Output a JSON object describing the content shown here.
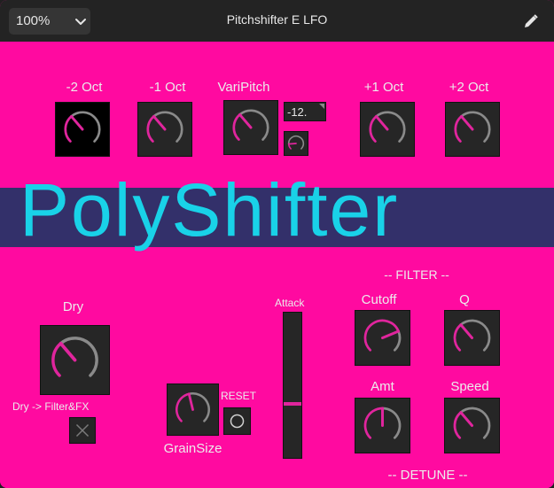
{
  "window": {
    "zoom": "100%",
    "title": "Pitchshifter E LFO"
  },
  "icons": {
    "zoom_chevron": "chevron-down-icon",
    "edit": "pencil-icon"
  },
  "colors": {
    "background": "#ff0aa0",
    "knob_indicator": "#e0259d",
    "title_text": "#19d2e8",
    "banner": "#33306a"
  },
  "plugin": {
    "title": "PolyShifter",
    "labels": {
      "minus2oct": "-2 Oct",
      "minus1oct": "-1 Oct",
      "varipitch": "VariPitch",
      "plus1oct": "+1 Oct",
      "plus2oct": "+2 Oct",
      "filter_header": "-- FILTER --",
      "dry": "Dry",
      "dry_routing": "Dry -> Filter&FX",
      "attack": "Attack",
      "reset": "RESET",
      "grainsize": "GrainSize",
      "cutoff": "Cutoff",
      "q": "Q",
      "amt": "Amt",
      "speed": "Speed",
      "detune_header": "-- DETUNE --"
    },
    "varipitch_value": "-12.",
    "knob_levels": {
      "minus2oct": 0.35,
      "minus1oct": 0.35,
      "varipitch": 0.35,
      "varipitch_small": 0.15,
      "plus1oct": 0.35,
      "plus2oct": 0.35,
      "dry": 0.35,
      "grainsize": 0.45,
      "cutoff": 0.75,
      "q": 0.35,
      "amt": 0.5,
      "speed": 0.35
    },
    "attack_level": 0.37,
    "reset_active": false,
    "dry_routing_enabled": true
  }
}
